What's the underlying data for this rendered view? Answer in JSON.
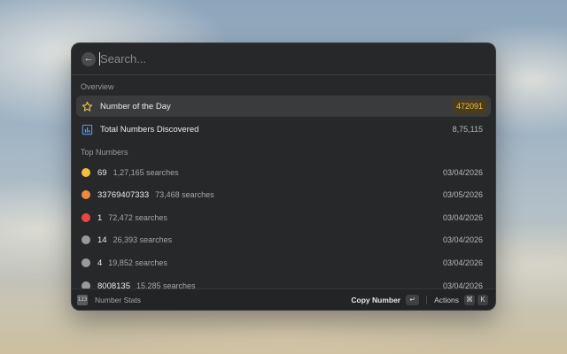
{
  "search": {
    "placeholder": "Search..."
  },
  "sections": {
    "overview": "Overview",
    "top_numbers": "Top Numbers"
  },
  "overview_items": [
    {
      "title": "Number of the Day",
      "badge": "472091",
      "icon": "star-icon"
    },
    {
      "title": "Total Numbers Discovered",
      "value": "8,75,115",
      "icon": "bar-chart-icon"
    }
  ],
  "top_numbers": [
    {
      "number": "69",
      "searches": "1,27,165 searches",
      "date": "03/04/2026",
      "color": "#f2bf3f"
    },
    {
      "number": "33769407333",
      "searches": "73,468 searches",
      "date": "03/05/2026",
      "color": "#ef8a3c"
    },
    {
      "number": "1",
      "searches": "72,472 searches",
      "date": "03/04/2026",
      "color": "#e8473f"
    },
    {
      "number": "14",
      "searches": "26,393 searches",
      "date": "03/04/2026",
      "color": "#9a9a9a"
    },
    {
      "number": "4",
      "searches": "19,852 searches",
      "date": "03/04/2026",
      "color": "#9a9a9a"
    },
    {
      "number": "8008135",
      "searches": "15,285 searches",
      "date": "03/04/2026",
      "color": "#9a9a9a"
    }
  ],
  "footer": {
    "extension_name": "Number Stats",
    "extension_icon_text": "123",
    "primary_action": "Copy Number",
    "primary_key": "↵",
    "actions_label": "Actions",
    "actions_keys": [
      "⌘",
      "K"
    ]
  },
  "colors": {
    "accent": "#f0c24a",
    "badge_bg": "#4a3d1c",
    "chart_icon": "#5a9be8"
  }
}
